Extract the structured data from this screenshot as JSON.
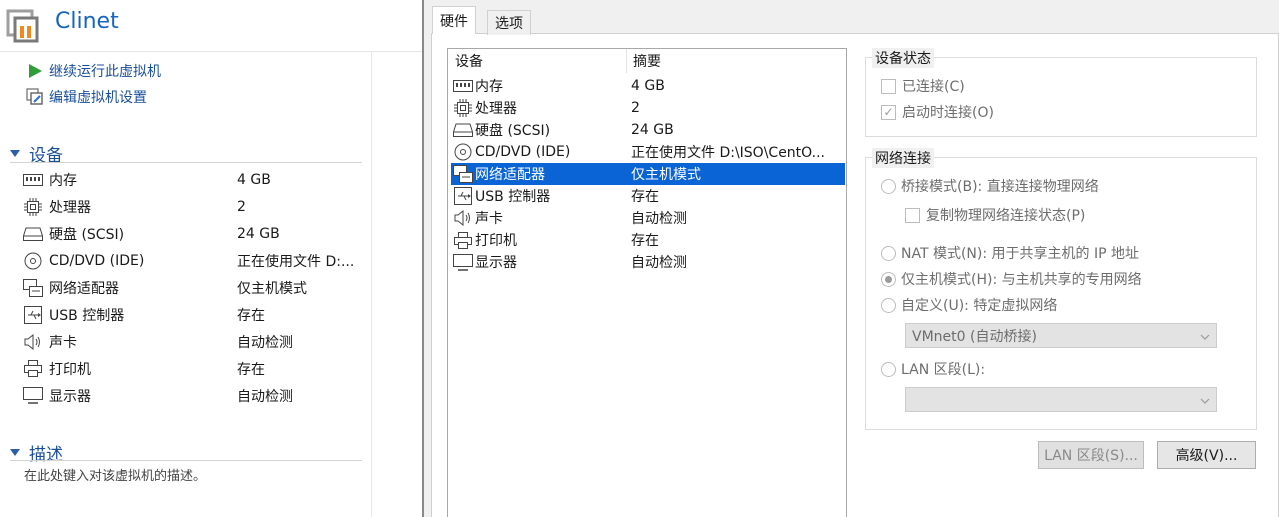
{
  "vm": {
    "title": "Clinet",
    "actions": [
      {
        "label": "继续运行此虚拟机",
        "icon": "play-icon"
      },
      {
        "label": "编辑虚拟机设置",
        "icon": "edit-settings-icon"
      }
    ],
    "devices_section_title": "设备",
    "devices": [
      {
        "name": "内存",
        "value": "4 GB",
        "icon": "memory-icon"
      },
      {
        "name": "处理器",
        "value": "2",
        "icon": "cpu-icon"
      },
      {
        "name": "硬盘 (SCSI)",
        "value": "24 GB",
        "icon": "hard-disk-icon"
      },
      {
        "name": "CD/DVD (IDE)",
        "value": "正在使用文件 D:...",
        "icon": "cd-dvd-icon"
      },
      {
        "name": "网络适配器",
        "value": "仅主机模式",
        "icon": "network-adapter-icon"
      },
      {
        "name": "USB 控制器",
        "value": "存在",
        "icon": "usb-icon"
      },
      {
        "name": "声卡",
        "value": "自动检测",
        "icon": "sound-icon"
      },
      {
        "name": "打印机",
        "value": "存在",
        "icon": "printer-icon"
      },
      {
        "name": "显示器",
        "value": "自动检测",
        "icon": "display-icon"
      }
    ],
    "description_section_title": "描述",
    "description_placeholder": "在此处键入对该虚拟机的描述。"
  },
  "dialog": {
    "tabs": [
      {
        "label": "硬件",
        "active": true
      },
      {
        "label": "选项",
        "active": false
      }
    ],
    "hardware_list": {
      "headers": {
        "device": "设备",
        "summary": "摘要"
      },
      "rows": [
        {
          "name": "内存",
          "summary": "4 GB",
          "icon": "memory-icon",
          "selected": false
        },
        {
          "name": "处理器",
          "summary": "2",
          "icon": "cpu-icon",
          "selected": false
        },
        {
          "name": "硬盘 (SCSI)",
          "summary": "24 GB",
          "icon": "hard-disk-icon",
          "selected": false
        },
        {
          "name": "CD/DVD (IDE)",
          "summary": "正在使用文件 D:\\ISO\\CentO...",
          "icon": "cd-dvd-icon",
          "selected": false
        },
        {
          "name": "网络适配器",
          "summary": "仅主机模式",
          "icon": "network-adapter-icon",
          "selected": true
        },
        {
          "name": "USB 控制器",
          "summary": "存在",
          "icon": "usb-icon",
          "selected": false
        },
        {
          "name": "声卡",
          "summary": "自动检测",
          "icon": "sound-icon",
          "selected": false
        },
        {
          "name": "打印机",
          "summary": "存在",
          "icon": "printer-icon",
          "selected": false
        },
        {
          "name": "显示器",
          "summary": "自动检测",
          "icon": "display-icon",
          "selected": false
        }
      ]
    },
    "device_status": {
      "title": "设备状态",
      "connected": {
        "label": "已连接(C)",
        "checked": false
      },
      "connect_at_power_on": {
        "label": "启动时连接(O)",
        "checked": true
      }
    },
    "network_connection": {
      "title": "网络连接",
      "bridged": {
        "label": "桥接模式(B): 直接连接物理网络",
        "selected": false
      },
      "replicate_state": {
        "label": "复制物理网络连接状态(P)",
        "checked": false
      },
      "nat": {
        "label": "NAT 模式(N): 用于共享主机的 IP 地址",
        "selected": false
      },
      "host_only": {
        "label": "仅主机模式(H): 与主机共享的专用网络",
        "selected": true
      },
      "custom": {
        "label": "自定义(U): 特定虚拟网络",
        "selected": false
      },
      "custom_select_value": "VMnet0 (自动桥接)",
      "lan_segment": {
        "label": "LAN 区段(L):",
        "selected": false
      },
      "lan_select_value": ""
    },
    "buttons": {
      "lan_segments": "LAN 区段(S)...",
      "advanced": "高级(V)..."
    }
  },
  "colors": {
    "accent_title": "#1565c0",
    "link": "#1a4f9c",
    "selection": "#0a64d6",
    "play_green": "#2e9e3a"
  }
}
